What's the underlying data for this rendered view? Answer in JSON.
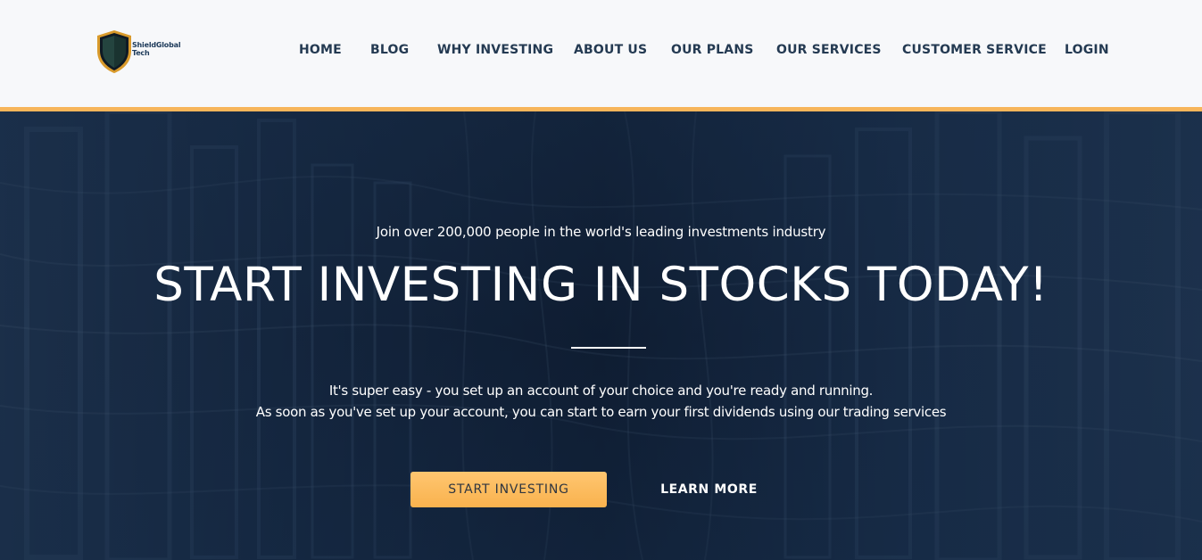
{
  "brand": {
    "line1": "ShieldGlobal",
    "line2": "Tech",
    "colors": {
      "shield_gold": "#d99a2b",
      "shield_dark": "#17232e",
      "navy": "#1d3a5a"
    }
  },
  "nav": {
    "items": [
      {
        "label": "HOME"
      },
      {
        "label": "BLOG"
      },
      {
        "label": "WHY INVESTING"
      },
      {
        "label": "ABOUT US"
      },
      {
        "label": "OUR PLANS"
      },
      {
        "label": "OUR SERVICES"
      },
      {
        "label": "CUSTOMER SERVICE"
      },
      {
        "label": "LOGIN"
      }
    ]
  },
  "colors": {
    "accent": "#f7b55a",
    "header_bg": "#f7f8fa",
    "nav_text": "#243a52",
    "hero_overlay": "#14263e"
  },
  "hero": {
    "tagline": "Join over 200,000 people in the world's leading investments industry",
    "headline": "START INVESTING IN STOCKS TODAY!",
    "description_line1": "It's super easy - you set up an account of your choice and you're ready and running.",
    "description_line2": "As soon as you've set up your account, you can start to earn your first dividends using our trading services",
    "primary_button": "START INVESTING",
    "secondary_button": "LEARN MORE"
  }
}
